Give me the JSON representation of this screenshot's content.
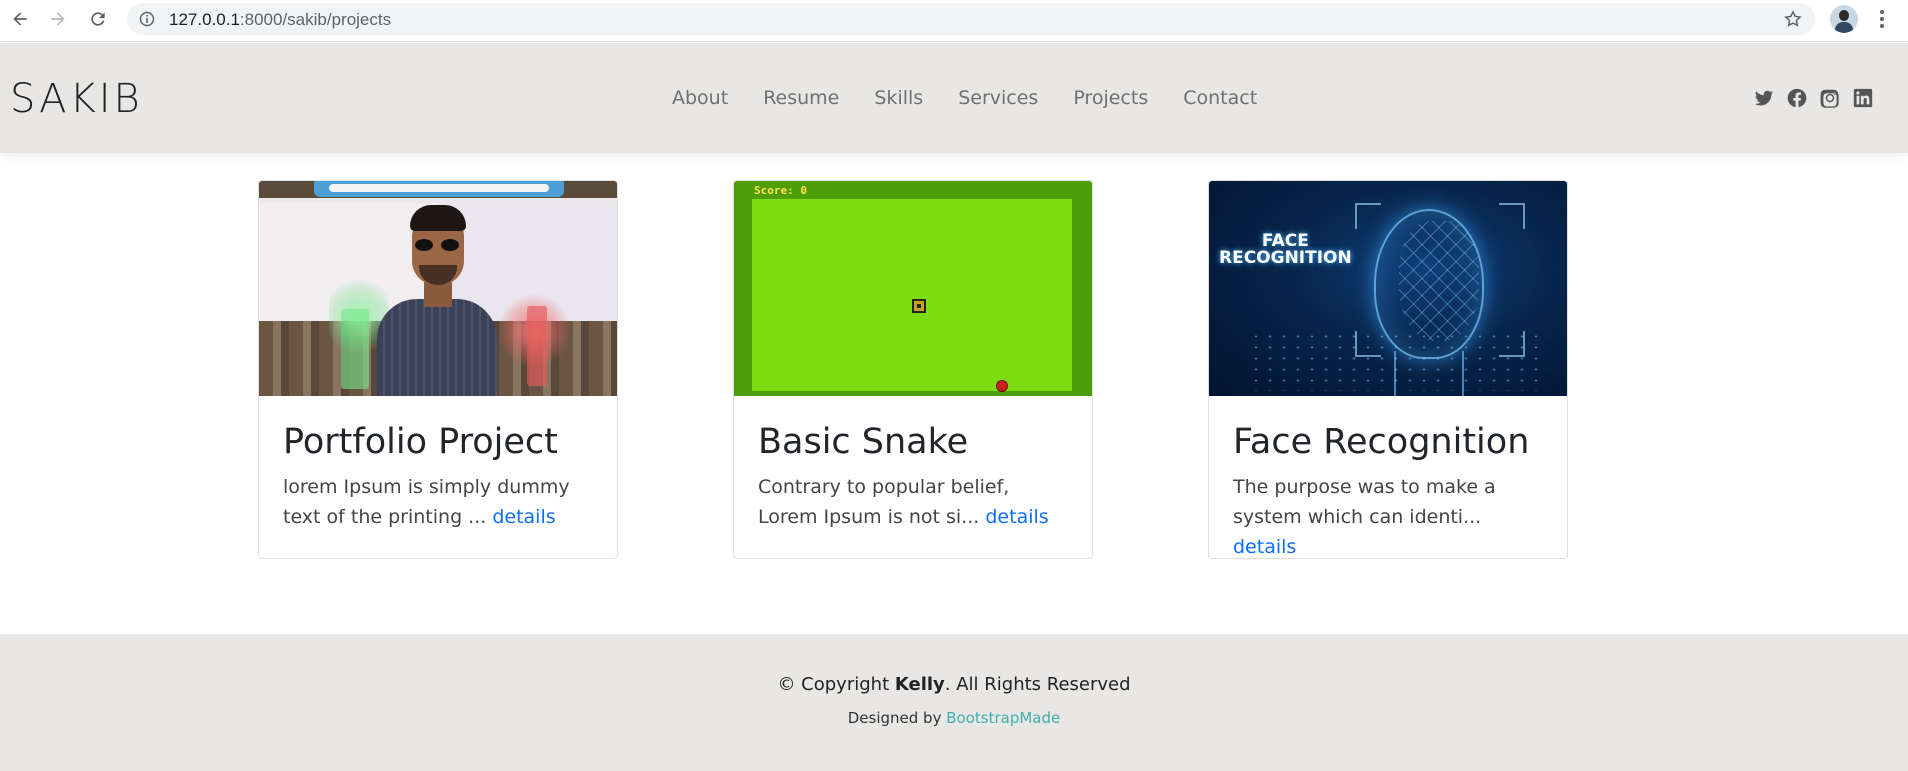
{
  "browser": {
    "url_host": "127.0.0.1",
    "url_rest": ":8000/sakib/projects"
  },
  "header": {
    "logo": "SAKIB",
    "nav": [
      "About",
      "Resume",
      "Skills",
      "Services",
      "Projects",
      "Contact"
    ],
    "socials": [
      "twitter-icon",
      "facebook-icon",
      "instagram-icon",
      "linkedin-icon"
    ]
  },
  "projects": [
    {
      "title": "Portfolio Project",
      "excerpt": "lorem Ipsum is simply dummy text of the printing ... ",
      "link": "details",
      "image": "portrait-photo"
    },
    {
      "title": "Basic Snake",
      "excerpt": "Contrary to popular belief, Lorem Ipsum is not si... ",
      "link": "details",
      "image": "snake-game-screenshot",
      "image_score_text": "Score: 0"
    },
    {
      "title": "Face Recognition",
      "excerpt": "The purpose was to make a system which can identi... ",
      "link": "details",
      "image": "face-recognition-graphic",
      "image_title_line1": "FACE",
      "image_title_line2": "RECOGNITION"
    }
  ],
  "footer": {
    "copyright_prefix": "© Copyright ",
    "copyright_name": "Kelly",
    "copyright_suffix": ". All Rights Reserved",
    "designed_by": "Designed by ",
    "designer": "BootstrapMade"
  },
  "colors": {
    "header_bg": "#e8e7e5",
    "link_blue": "#0d6efd",
    "credit_teal": "#3fb0ac"
  }
}
